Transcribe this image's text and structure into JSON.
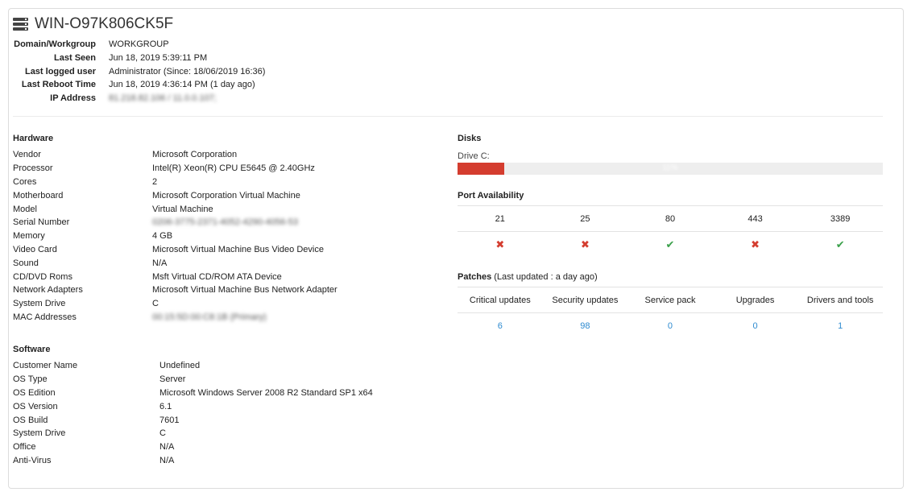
{
  "device": {
    "icon": "server-icon",
    "name": "WIN-O97K806CK5F"
  },
  "summary": [
    {
      "label": "Domain/Workgroup",
      "value": "WORKGROUP"
    },
    {
      "label": "Last Seen",
      "value": "Jun 18, 2019 5:39:11 PM"
    },
    {
      "label": "Last logged user",
      "value": "Administrator (Since: 18/06/2019 16:36)"
    },
    {
      "label": "Last Reboot Time",
      "value": "Jun 18, 2019 4:36:14 PM (1 day ago)"
    },
    {
      "label": "IP Address",
      "value": "81.218.82.106 / 11.0.0.107;"
    }
  ],
  "hardware": {
    "title": "Hardware",
    "rows": [
      {
        "label": "Vendor",
        "value": "Microsoft Corporation"
      },
      {
        "label": "Processor",
        "value": "Intel(R) Xeon(R) CPU E5645 @ 2.40GHz"
      },
      {
        "label": "Cores",
        "value": "2"
      },
      {
        "label": "Motherboard",
        "value": "Microsoft Corporation Virtual Machine"
      },
      {
        "label": "Model",
        "value": "Virtual Machine"
      },
      {
        "label": "Serial Number",
        "value": "0206-3775-2371-4052-4290-4056-53"
      },
      {
        "label": "Memory",
        "value": "4 GB"
      },
      {
        "label": "Video Card",
        "value": "Microsoft Virtual Machine Bus Video Device"
      },
      {
        "label": "Sound",
        "value": "N/A"
      },
      {
        "label": "CD/DVD Roms",
        "value": "Msft Virtual CD/ROM ATA Device"
      },
      {
        "label": "Network Adapters",
        "value": "Microsoft Virtual Machine Bus Network Adapter"
      },
      {
        "label": "System Drive",
        "value": "C"
      },
      {
        "label": "MAC Addresses",
        "value": "00:15:5D:00:C8:1B (Primary)"
      }
    ]
  },
  "software": {
    "title": "Software",
    "rows": [
      {
        "label": "Customer Name",
        "value": "Undefined"
      },
      {
        "label": "OS Type",
        "value": "Server"
      },
      {
        "label": "OS Edition",
        "value": "Microsoft Windows Server 2008 R2 Standard SP1 x64"
      },
      {
        "label": "OS Version",
        "value": "6.1"
      },
      {
        "label": "OS Build",
        "value": "7601"
      },
      {
        "label": "System Drive",
        "value": "C"
      },
      {
        "label": "Office",
        "value": "N/A"
      },
      {
        "label": "Anti-Virus",
        "value": "N/A"
      }
    ]
  },
  "disks": {
    "title": "Disks",
    "drives": [
      {
        "label": "Drive C:",
        "used_fraction": 0.11,
        "percent_text": "11%",
        "color": "#d43d2f"
      }
    ]
  },
  "ports": {
    "title": "Port Availability",
    "items": [
      {
        "port": "21",
        "status": "closed",
        "icon": "x-icon"
      },
      {
        "port": "25",
        "status": "closed",
        "icon": "x-icon"
      },
      {
        "port": "80",
        "status": "open",
        "icon": "check-icon"
      },
      {
        "port": "443",
        "status": "closed",
        "icon": "x-icon"
      },
      {
        "port": "3389",
        "status": "open",
        "icon": "check-icon"
      }
    ],
    "colors": {
      "open": "#3aa04a",
      "closed": "#d43d2f"
    }
  },
  "patches": {
    "title": "Patches",
    "subtitle": "(Last updated : a day ago)",
    "columns": [
      {
        "label": "Critical updates",
        "count": "6"
      },
      {
        "label": "Security updates",
        "count": "98"
      },
      {
        "label": "Service pack",
        "count": "0"
      },
      {
        "label": "Upgrades",
        "count": "0"
      },
      {
        "label": "Drivers and tools",
        "count": "1"
      }
    ],
    "link_color": "#2e8bd0"
  }
}
